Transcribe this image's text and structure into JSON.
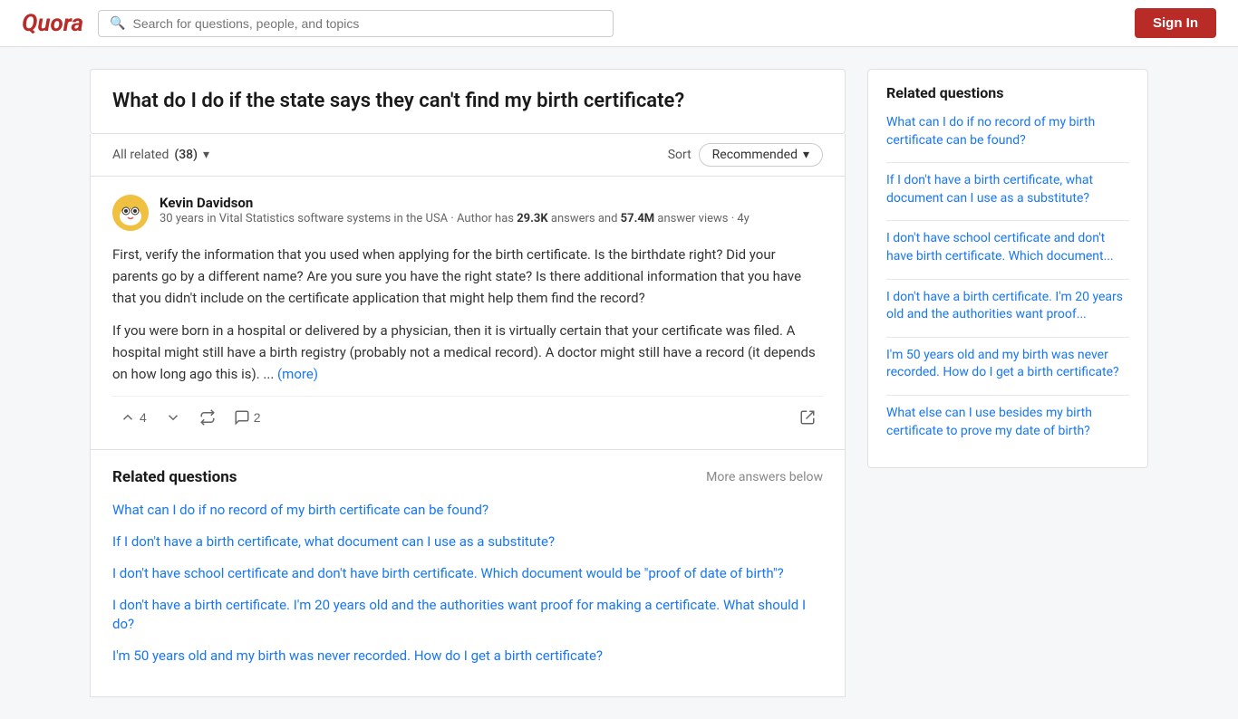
{
  "header": {
    "logo": "Quora",
    "search_placeholder": "Search for questions, people, and topics",
    "sign_in_label": "Sign In"
  },
  "question": {
    "title": "What do I do if the state says they can't find my birth certificate?"
  },
  "filter_bar": {
    "all_related_label": "All related",
    "count": "(38)",
    "sort_label": "Sort",
    "sort_selected": "Recommended"
  },
  "answer": {
    "author_name": "Kevin Davidson",
    "author_bio": "30 years in Vital Statistics software systems in the USA · Author has",
    "author_stats": "29.3K",
    "author_stats2": "57.4M",
    "author_bio2": "answers and",
    "author_bio3": "answer views · 4y",
    "paragraph1": "First, verify the information that you used when applying for the birth certificate. Is the birthdate right? Did your parents go by a different name? Are you sure you have the right state? Is there additional information that you have that you didn't include on the certificate application that might help them find the record?",
    "paragraph2": "If you were born in a hospital or delivered by a physician, then it is virtually certain that your certificate was filed. A hospital might still have a birth registry (probably not a medical record). A doctor might still have a record (it depends on how long ago this is). ...",
    "more_label": "(more)",
    "upvote_count": "4",
    "comment_count": "2"
  },
  "related_main": {
    "title": "Related questions",
    "more_answers": "More answers below",
    "links": [
      "What can I do if no record of my birth certificate can be found?",
      "If I don't have a birth certificate, what document can I use as a substitute?",
      "I don't have school certificate and don't have birth certificate. Which document would be \"proof of date of birth\"?",
      "I don't have a birth certificate. I'm 20 years old and the authorities want proof for making a certificate. What should I do?",
      "I'm 50 years old and my birth was never recorded. How do I get a birth certificate?"
    ]
  },
  "sidebar": {
    "title": "Related questions",
    "links": [
      "What can I do if no record of my birth certificate can be found?",
      "If I don't have a birth certificate, what document can I use as a substitute?",
      "I don't have school certificate and don't have birth certificate. Which document...",
      "I don't have a birth certificate. I'm 20 years old and the authorities want proof...",
      "I'm 50 years old and my birth was never recorded. How do I get a birth certificate?",
      "What else can I use besides my birth certificate to prove my date of birth?"
    ]
  },
  "icons": {
    "search": "🔍",
    "chevron_down": "▾",
    "upvote": "↑",
    "downvote": "↓",
    "reshare": "↻",
    "comment": "💬",
    "share": "↗",
    "avatar_emoji": "🧑"
  }
}
